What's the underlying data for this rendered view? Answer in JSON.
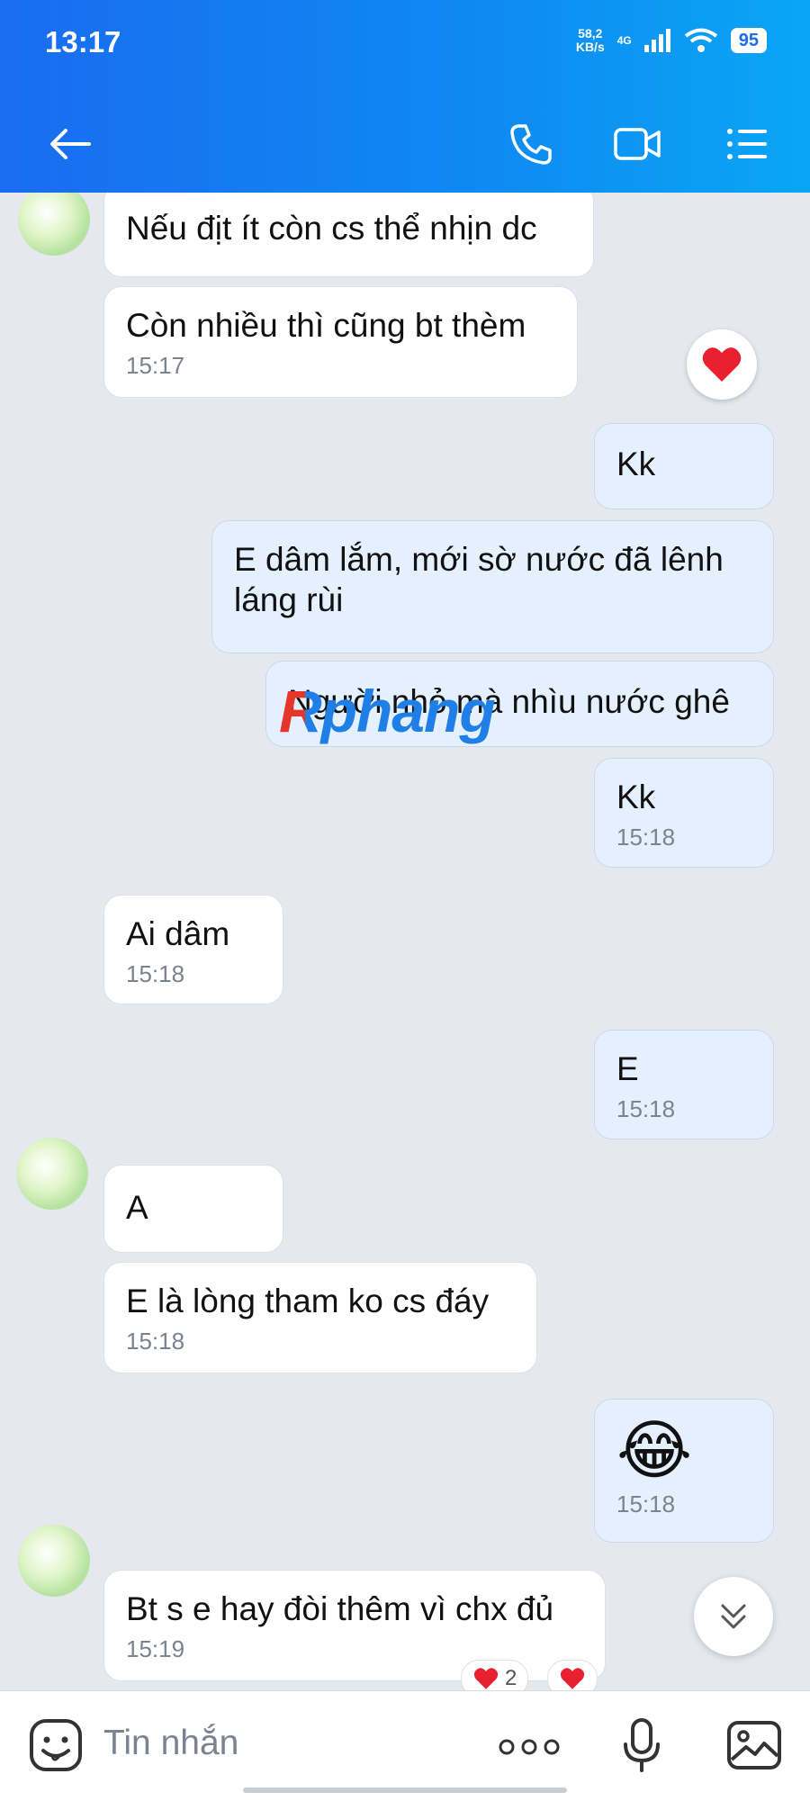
{
  "status_bar": {
    "time": "13:17",
    "net_speed_value": "58,2",
    "net_speed_unit": "KB/s",
    "network": "4G",
    "battery": "95"
  },
  "header": {
    "icons": [
      "back-arrow-icon",
      "phone-icon",
      "video-call-icon",
      "menu-icon"
    ]
  },
  "messages": [
    {
      "side": "in",
      "text": "Nếu địt ít còn cs thể nhịn dc",
      "time": ""
    },
    {
      "side": "in",
      "text": "Còn nhiều thì cũng bt thèm",
      "time": "15:17",
      "reaction": "heart"
    },
    {
      "side": "out",
      "text": "Kk",
      "time": ""
    },
    {
      "side": "out",
      "text": "E dâm lắm, mới sờ nước đã lênh láng rùi",
      "time": ""
    },
    {
      "side": "out",
      "text": "Người nhỏ mà nhìu nước ghê",
      "time": ""
    },
    {
      "side": "out",
      "text": "Kk",
      "time": "15:18"
    },
    {
      "side": "in",
      "text": "Ai dâm",
      "time": "15:18"
    },
    {
      "side": "out",
      "text": "E",
      "time": "15:18"
    },
    {
      "side": "in",
      "text": "A",
      "time": ""
    },
    {
      "side": "in",
      "text": "E là lòng tham ko cs đáy",
      "time": "15:18"
    },
    {
      "side": "out",
      "text": "😂",
      "time": "15:18"
    },
    {
      "side": "in",
      "text": "Bt s e hay đòi thêm vì chx đủ",
      "time": "15:19",
      "reaction_count": "2"
    }
  ],
  "watermark": "Rphang",
  "composer": {
    "placeholder": "Tin nhắn"
  },
  "colors": {
    "header_start": "#1a6cf0",
    "header_end": "#0aa6f5",
    "incoming_bubble": "#ffffff",
    "outgoing_bubble": "#e4f0fd",
    "heart": "#e8202f"
  }
}
